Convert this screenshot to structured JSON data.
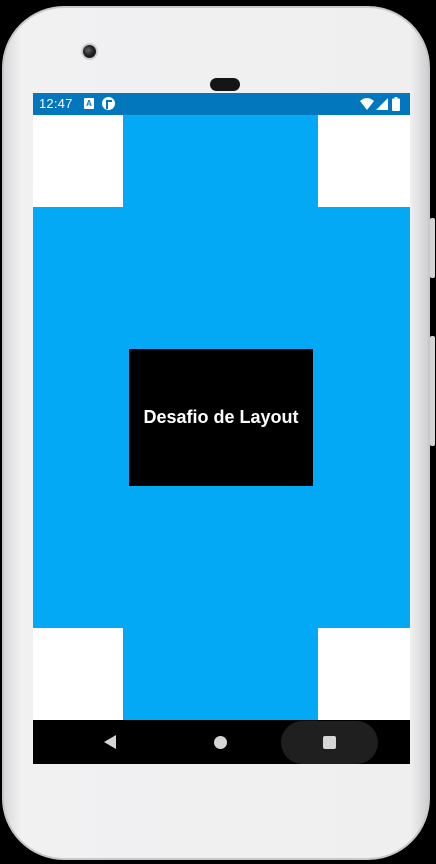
{
  "status_bar": {
    "time": "12:47",
    "notification_icon_letter": "A",
    "icons": [
      "a-notification-icon",
      "app-notification-icon",
      "wifi-icon",
      "signal-icon",
      "battery-icon"
    ],
    "color": "#0277bd"
  },
  "main": {
    "title": "Desafio de Layout",
    "colors": {
      "blue": "#03a9f4",
      "box": "#000000",
      "corners": "#ffffff"
    }
  },
  "nav_bar": {
    "icons": [
      "back-icon",
      "home-icon",
      "recents-icon"
    ]
  }
}
